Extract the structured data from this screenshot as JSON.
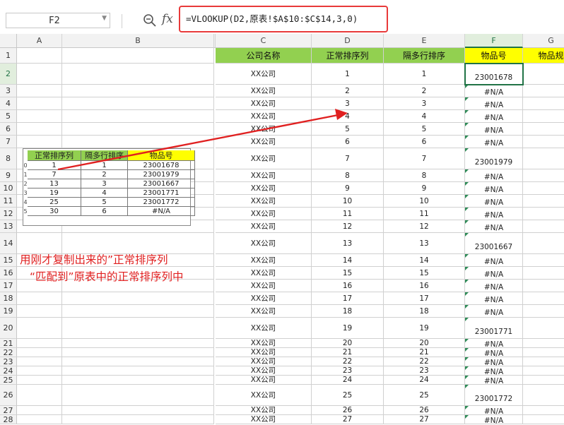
{
  "name_box": "F2",
  "formula": "=VLOOKUP(D2,原表!$A$10:$C$14,3,0)",
  "columns": {
    "A": "A",
    "B": "B",
    "C": "C",
    "D": "D",
    "E": "E",
    "F": "F",
    "G": "G"
  },
  "header_row": {
    "c": "公司名称",
    "d": "正常排序列",
    "e": "隔多行排序",
    "f": "物品号",
    "g": "物品规"
  },
  "rows": [
    {
      "n": "1"
    },
    {
      "n": "2",
      "c": "XX公司",
      "d": "1",
      "e": "1",
      "f": "23001678"
    },
    {
      "n": "3",
      "c": "XX公司",
      "d": "2",
      "e": "2",
      "f": "#N/A"
    },
    {
      "n": "4",
      "c": "XX公司",
      "d": "3",
      "e": "3",
      "f": "#N/A"
    },
    {
      "n": "5",
      "c": "XX公司",
      "d": "4",
      "e": "4",
      "f": "#N/A"
    },
    {
      "n": "6",
      "c": "XX公司",
      "d": "5",
      "e": "5",
      "f": "#N/A"
    },
    {
      "n": "7",
      "c": "XX公司",
      "d": "6",
      "e": "6",
      "f": "#N/A"
    },
    {
      "n": "8",
      "c": "XX公司",
      "d": "7",
      "e": "7",
      "f": "23001979"
    },
    {
      "n": "9",
      "c": "XX公司",
      "d": "8",
      "e": "8",
      "f": "#N/A"
    },
    {
      "n": "10",
      "c": "XX公司",
      "d": "9",
      "e": "9",
      "f": "#N/A"
    },
    {
      "n": "11",
      "c": "XX公司",
      "d": "10",
      "e": "10",
      "f": "#N/A"
    },
    {
      "n": "12",
      "c": "XX公司",
      "d": "11",
      "e": "11",
      "f": "#N/A"
    },
    {
      "n": "13",
      "c": "XX公司",
      "d": "12",
      "e": "12",
      "f": "#N/A"
    },
    {
      "n": "14",
      "c": "XX公司",
      "d": "13",
      "e": "13",
      "f": "23001667"
    },
    {
      "n": "15",
      "c": "XX公司",
      "d": "14",
      "e": "14",
      "f": "#N/A"
    },
    {
      "n": "16",
      "c": "XX公司",
      "d": "15",
      "e": "15",
      "f": "#N/A"
    },
    {
      "n": "17",
      "c": "XX公司",
      "d": "16",
      "e": "16",
      "f": "#N/A"
    },
    {
      "n": "18",
      "c": "XX公司",
      "d": "17",
      "e": "17",
      "f": "#N/A"
    },
    {
      "n": "19",
      "c": "XX公司",
      "d": "18",
      "e": "18",
      "f": "#N/A"
    },
    {
      "n": "20",
      "c": "XX公司",
      "d": "19",
      "e": "19",
      "f": "23001771"
    },
    {
      "n": "21",
      "c": "XX公司",
      "d": "20",
      "e": "20",
      "f": "#N/A"
    },
    {
      "n": "22",
      "c": "XX公司",
      "d": "21",
      "e": "21",
      "f": "#N/A"
    },
    {
      "n": "23",
      "c": "XX公司",
      "d": "22",
      "e": "22",
      "f": "#N/A"
    },
    {
      "n": "24",
      "c": "XX公司",
      "d": "23",
      "e": "23",
      "f": "#N/A"
    },
    {
      "n": "25",
      "c": "XX公司",
      "d": "24",
      "e": "24",
      "f": "#N/A"
    },
    {
      "n": "26",
      "c": "XX公司",
      "d": "25",
      "e": "25",
      "f": "23001772"
    },
    {
      "n": "27",
      "c": "XX公司",
      "d": "26",
      "e": "26",
      "f": "#N/A"
    },
    {
      "n": "28",
      "c": "XX公司",
      "d": "27",
      "e": "27",
      "f": "#N/A"
    }
  ],
  "pasted_table": {
    "headers": [
      "正常排序列",
      "隔多行排序",
      "物品号"
    ],
    "rows": [
      [
        "1",
        "1",
        "23001678"
      ],
      [
        "7",
        "2",
        "23001979"
      ],
      [
        "13",
        "3",
        "23001667"
      ],
      [
        "19",
        "4",
        "23001771"
      ],
      [
        "25",
        "5",
        "23001772"
      ],
      [
        "30",
        "6",
        "#N/A"
      ]
    ],
    "edge_labels": [
      "0",
      "1",
      "2",
      "3",
      "4",
      "5"
    ]
  },
  "annotation": {
    "line1": "用刚才复制出来的”正常排序列",
    "line2": "“匹配到”原表中的正常排序列中"
  },
  "colors": {
    "header_green": "#92d050",
    "highlight_yellow": "#ffff00",
    "annotation_red": "#e02020",
    "selection_green": "#217346"
  }
}
